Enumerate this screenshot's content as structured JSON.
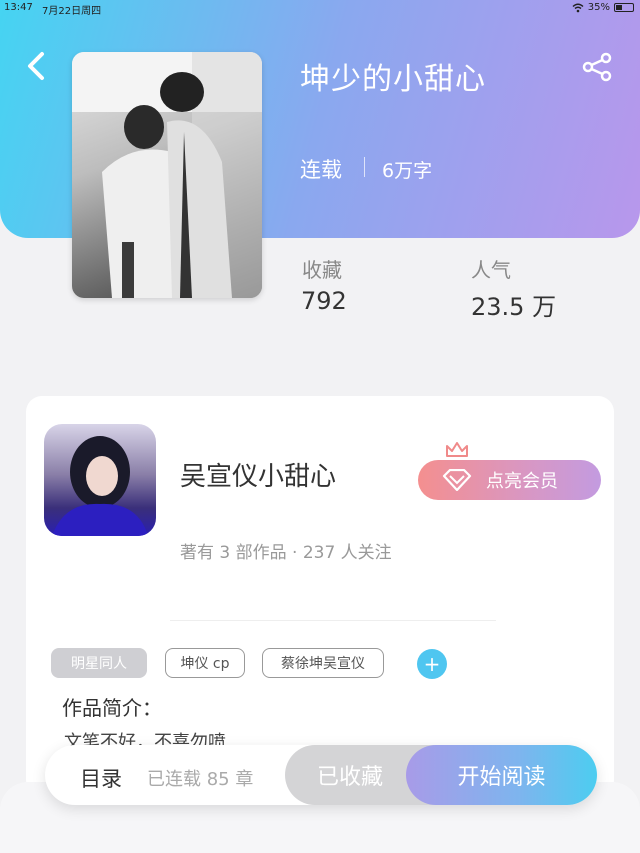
{
  "status_bar": {
    "time": "13:47",
    "date": "7月22日周四",
    "battery": "35%",
    "battery_level": 0.35
  },
  "book": {
    "title": "坤少的小甜心",
    "status": "连载",
    "word_count": "6万字",
    "stats": [
      {
        "label": "收藏",
        "value": "792"
      },
      {
        "label": "人气",
        "value": "23.5 万"
      }
    ]
  },
  "author": {
    "name": "吴宣仪小甜心",
    "meta": "著有 3 部作品 · 237 人关注",
    "vip_button": "点亮会员"
  },
  "tags": [
    "明星同人",
    "坤仪 cp",
    "蔡徐坤吴宣仪"
  ],
  "intro": {
    "label": "作品简介：",
    "text": "文笔不好，不喜勿喷"
  },
  "bottom_bar": {
    "toc": "目录",
    "chapters": "已连载 85 章",
    "collected": "已收藏",
    "read": "开始阅读"
  },
  "colors": {
    "header_start": "#45d4f2",
    "header_end": "#b897ec",
    "accent_blue": "#4fc6f0",
    "vip_pink": "#f48f8f"
  },
  "icons": [
    "back-icon",
    "share-icon",
    "crown-icon",
    "diamond-icon",
    "plus-icon",
    "wifi-icon"
  ]
}
